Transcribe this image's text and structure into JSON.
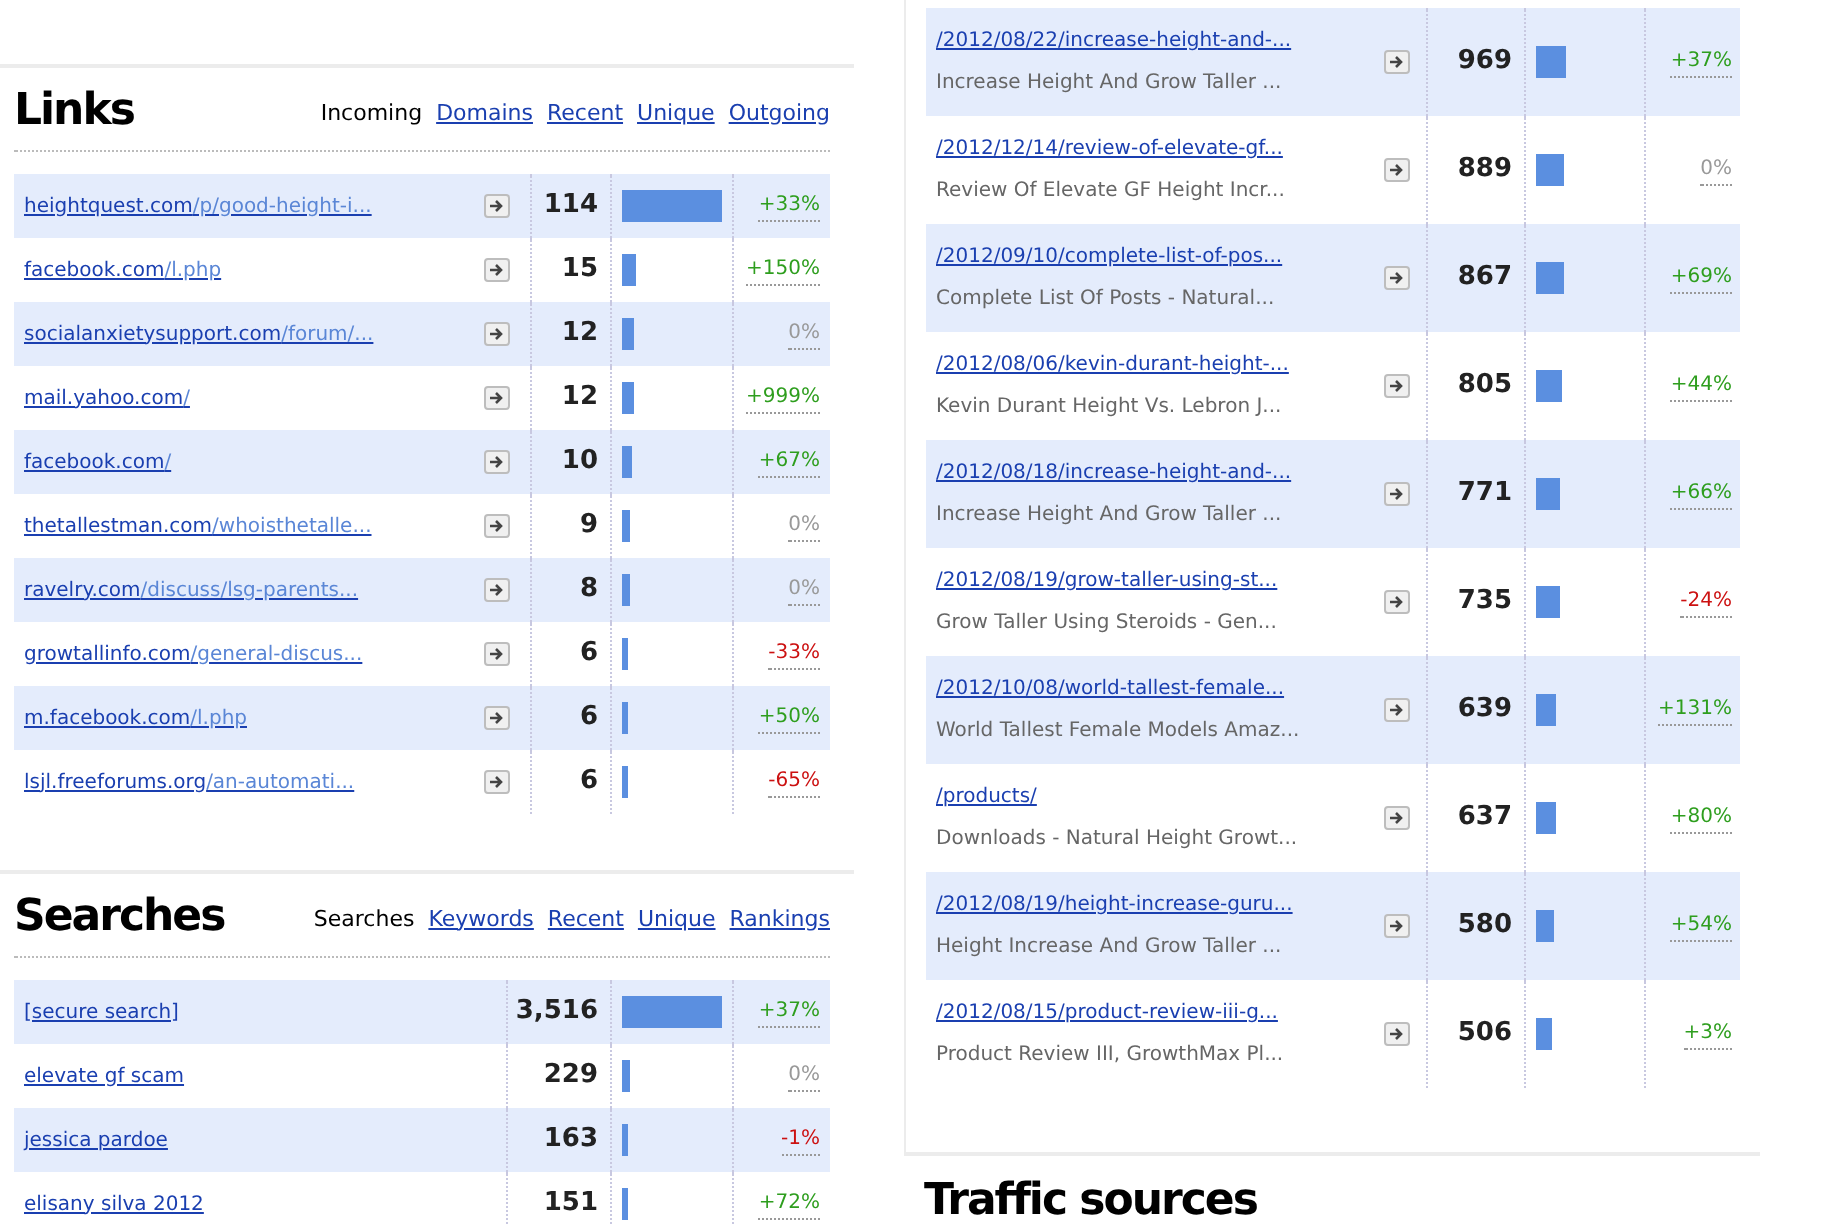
{
  "links": {
    "title": "Links",
    "tabs": [
      {
        "label": "Incoming",
        "selected": true
      },
      {
        "label": "Domains",
        "selected": false
      },
      {
        "label": "Recent",
        "selected": false
      },
      {
        "label": "Unique",
        "selected": false
      },
      {
        "label": "Outgoing",
        "selected": false
      }
    ],
    "rows": [
      {
        "domain": "heightquest.com",
        "path": "/p/good-height-i...",
        "count": "114",
        "level": 1,
        "change": "+33%",
        "color": "#2e9e1e"
      },
      {
        "domain": "facebook.com",
        "path": "/l.php",
        "count": "15",
        "level": 0.13,
        "change": "+150%",
        "color": "#2e9e1e"
      },
      {
        "domain": "socialanxietysupport.com",
        "path": "/forum/...",
        "count": "12",
        "level": 0.11,
        "change": "0%",
        "color": "#999999"
      },
      {
        "domain": "mail.yahoo.com",
        "path": "/",
        "count": "12",
        "level": 0.11,
        "change": "+999%",
        "color": "#2e9e1e"
      },
      {
        "domain": "facebook.com",
        "path": "/",
        "count": "10",
        "level": 0.09,
        "change": "+67%",
        "color": "#2e9e1e"
      },
      {
        "domain": "thetallestman.com",
        "path": "/whoisthetalle...",
        "count": "9",
        "level": 0.08,
        "change": "0%",
        "color": "#999999"
      },
      {
        "domain": "ravelry.com",
        "path": "/discuss/lsg-parents...",
        "count": "8",
        "level": 0.07,
        "change": "0%",
        "color": "#999999"
      },
      {
        "domain": "growtallinfo.com",
        "path": "/general-discus...",
        "count": "6",
        "level": 0.05,
        "change": "-33%",
        "color": "#cc1111"
      },
      {
        "domain": "m.facebook.com",
        "path": "/l.php",
        "count": "6",
        "level": 0.05,
        "change": "+50%",
        "color": "#2e9e1e"
      },
      {
        "domain": "lsjl.freeforums.org",
        "path": "/an-automati...",
        "count": "6",
        "level": 0.05,
        "change": "-65%",
        "color": "#cc1111"
      }
    ]
  },
  "searches": {
    "title": "Searches",
    "tabs": [
      {
        "label": "Searches",
        "selected": true
      },
      {
        "label": "Keywords",
        "selected": false
      },
      {
        "label": "Recent",
        "selected": false
      },
      {
        "label": "Unique",
        "selected": false
      },
      {
        "label": "Rankings",
        "selected": false
      }
    ],
    "rows": [
      {
        "term": "[secure search]",
        "count": "3,516",
        "level": 1,
        "change": "+37%",
        "color": "#2e9e1e"
      },
      {
        "term": "elevate gf scam",
        "count": "229",
        "level": 0.07,
        "change": "0%",
        "color": "#999999"
      },
      {
        "term": "jessica pardoe",
        "count": "163",
        "level": 0.05,
        "change": "-1%",
        "color": "#cc1111"
      },
      {
        "term": "elisany silva 2012",
        "count": "151",
        "level": 0.05,
        "change": "+72%",
        "color": "#2e9e1e"
      }
    ]
  },
  "pages": {
    "rows": [
      {
        "url": "/2012/08/22/increase-height-and-...",
        "title": "Increase Height And Grow Taller ...",
        "count": "969",
        "level": 0.3,
        "change": "+37%",
        "color": "#2e9e1e"
      },
      {
        "url": "/2012/12/14/review-of-elevate-gf...",
        "title": "Review Of Elevate GF Height Incr...",
        "count": "889",
        "level": 0.28,
        "change": "0%",
        "color": "#999999"
      },
      {
        "url": "/2012/09/10/complete-list-of-pos...",
        "title": "Complete List Of Posts - Natural...",
        "count": "867",
        "level": 0.28,
        "change": "+69%",
        "color": "#2e9e1e"
      },
      {
        "url": "/2012/08/06/kevin-durant-height-...",
        "title": "Kevin Durant Height Vs. Lebron J...",
        "count": "805",
        "level": 0.26,
        "change": "+44%",
        "color": "#2e9e1e"
      },
      {
        "url": "/2012/08/18/increase-height-and-...",
        "title": "Increase Height And Grow Taller ...",
        "count": "771",
        "level": 0.24,
        "change": "+66%",
        "color": "#2e9e1e"
      },
      {
        "url": "/2012/08/19/grow-taller-using-st...",
        "title": "Grow Taller Using Steroids - Gen...",
        "count": "735",
        "level": 0.24,
        "change": "-24%",
        "color": "#cc1111"
      },
      {
        "url": "/2012/10/08/world-tallest-female...",
        "title": "World Tallest Female Models Amaz...",
        "count": "639",
        "level": 0.2,
        "change": "+131%",
        "color": "#2e9e1e"
      },
      {
        "url": "/products/",
        "title": "Downloads - Natural Height Growt...",
        "count": "637",
        "level": 0.2,
        "change": "+80%",
        "color": "#2e9e1e"
      },
      {
        "url": "/2012/08/19/height-increase-guru...",
        "title": "Height Increase And Grow Taller ...",
        "count": "580",
        "level": 0.18,
        "change": "+54%",
        "color": "#2e9e1e"
      },
      {
        "url": "/2012/08/15/product-review-iii-g...",
        "title": "Product Review III, GrowthMax Pl...",
        "count": "506",
        "level": 0.16,
        "change": "+3%",
        "color": "#2e9e1e"
      }
    ]
  },
  "traffic_sources": {
    "title": "Traffic sources"
  }
}
